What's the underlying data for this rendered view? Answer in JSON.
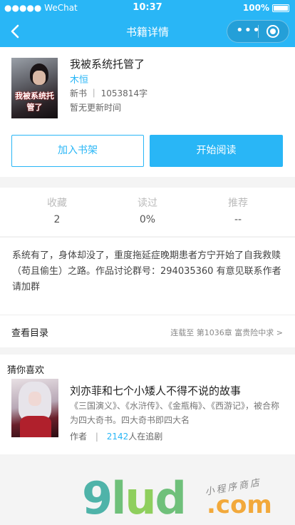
{
  "status_bar": {
    "carrier": "●●●●● WeChat",
    "time": "10:37",
    "battery": "100%"
  },
  "nav": {
    "title": "书籍详情"
  },
  "book": {
    "title": "我被系统托管了",
    "author": "木恒",
    "meta": "新书 ｜ 1053814字",
    "update": "暂无更新时间",
    "cover_text": "我被系统托管了"
  },
  "actions": {
    "add_shelf": "加入书架",
    "start_read": "开始阅读"
  },
  "stats": [
    {
      "label": "收藏",
      "value": "2"
    },
    {
      "label": "读过",
      "value": "0%"
    },
    {
      "label": "推荐",
      "value": "--"
    }
  ],
  "description": "系统有了，身体却没了，重度拖延症晚期患者方宁开始了自我救赎（苟且偷生）之路。作品讨论群号：294035360 有意见联系作者请加群",
  "toc": {
    "label": "查看目录",
    "status": "连载至 第1036章 富贵险中求 >"
  },
  "recommend": {
    "heading": "猜你喜欢",
    "title": "刘亦菲和七个小矮人不得不说的故事",
    "desc": "《三国演义》、《水浒传》、《金瓶梅》、《西游记》，被合称为四大奇书。四大奇书即四大名",
    "author_label": "作者",
    "count": "2142",
    "count_suffix": "人在追剧"
  },
  "watermark": {
    "logo": "glud",
    "suffix": ".com",
    "tagline": "小程序商店"
  },
  "colors": {
    "accent": "#29b6f6"
  }
}
